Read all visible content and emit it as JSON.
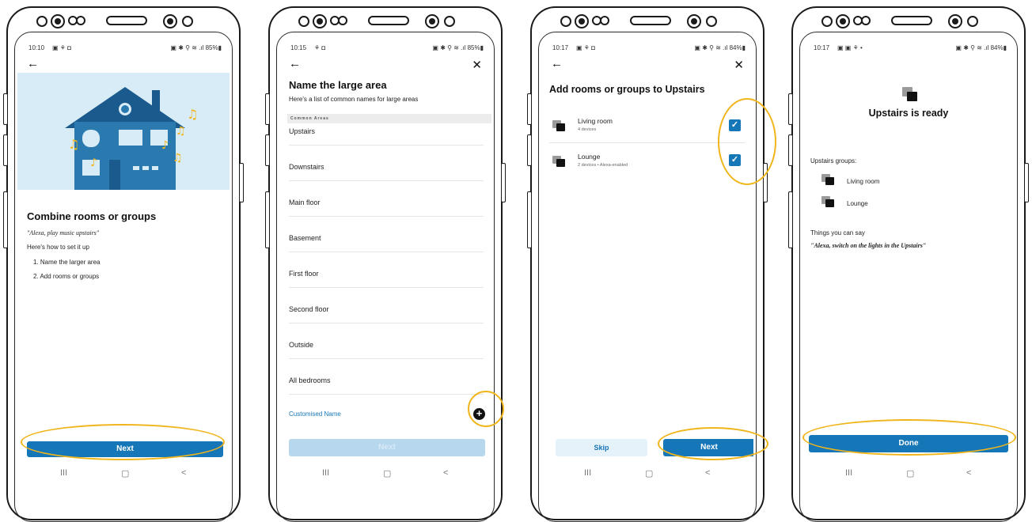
{
  "status_bars": [
    {
      "time": "10:10",
      "left_icons": "▣ ⚘ ◘",
      "right": "▣ ✱ ⚲ ≋ .ıl 85%▮"
    },
    {
      "time": "10:15",
      "left_icons": "⚘ ◘",
      "right": "▣ ✱ ⚲ ≋ .ıl 85%▮"
    },
    {
      "time": "10:17",
      "left_icons": "▣ ⚘ ◘",
      "right": "▣ ✱ ⚲ ≋ .ıl 84%▮"
    },
    {
      "time": "10:17",
      "left_icons": "▣ ▣ ⚘ •",
      "right": "▣ ✱ ⚲ ≋ .ıl 84%▮"
    }
  ],
  "screen1": {
    "title": "Combine rooms or groups",
    "quote": "\"Alexa, play music upstairs\"",
    "howto": "Here's how to set it up",
    "steps": [
      "1.   Name the larger area",
      "2.   Add rooms or groups"
    ],
    "next_label": "Next",
    "colors": {
      "illustration_bg": "#d8ecf7",
      "house": "#2a7ab0",
      "house_dark": "#1a5a8c",
      "notes": "#f1b51c"
    }
  },
  "screen2": {
    "title": "Name the large area",
    "subtitle": "Here's a list of common names for large areas",
    "section": "Common Areas",
    "items": [
      "Upstairs",
      "Downstairs",
      "Main floor",
      "Basement",
      "First floor",
      "Second floor",
      "Outside",
      "All bedrooms"
    ],
    "custom": "Customised Name",
    "next_label": "Next"
  },
  "screen3": {
    "title": "Add rooms or groups to Upstairs",
    "groups": [
      {
        "name": "Living room",
        "detail": "4 devices"
      },
      {
        "name": "Lounge",
        "detail": "2 devices • Alexa-enabled"
      }
    ],
    "skip_label": "Skip",
    "next_label": "Next"
  },
  "screen4": {
    "title": "Upstairs is ready",
    "groups_label": "Upstairs groups:",
    "groups": [
      "Living room",
      "Lounge"
    ],
    "things_label": "Things you can say",
    "quote": "\"Alexa, switch on the lights in the Upstairs\"",
    "done_label": "Done"
  },
  "navbar": {
    "recents": "III",
    "home": "▢",
    "back": "<"
  },
  "colors": {
    "accent": "#1677b8",
    "highlight": "#f1b51c",
    "disabled": "#b7d7ee",
    "skip_bg": "#e6f2f9"
  }
}
